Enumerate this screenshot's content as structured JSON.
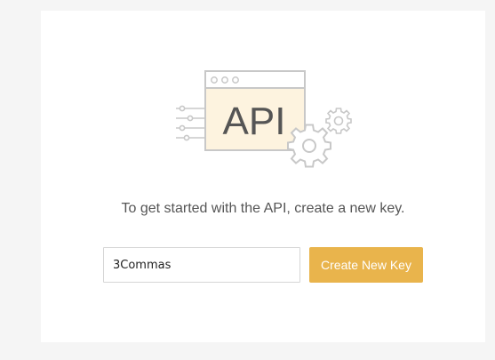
{
  "illustration": {
    "label": "API",
    "icon": "api-window-with-gears-icon"
  },
  "message": "To get started with the API, create a new key.",
  "key_form": {
    "input_value": "3Commas",
    "button_label": "Create New Key"
  },
  "colors": {
    "page_background": "#f5f5f5",
    "card_background": "#ffffff",
    "accent": "#e9b44c",
    "window_fill": "#fdf3df",
    "line_gray": "#c8c8c8",
    "text_gray": "#555555"
  }
}
